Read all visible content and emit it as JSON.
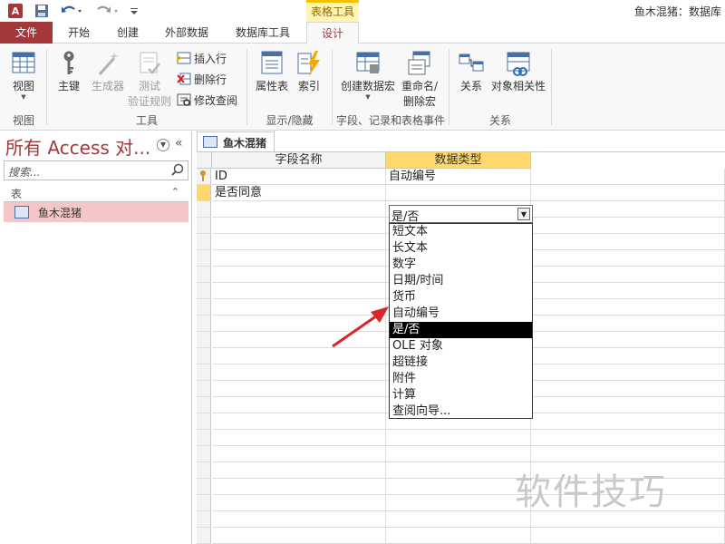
{
  "app_icon": "A",
  "context_tab": "表格工具",
  "window_title": "鱼木混猪：数据库",
  "tabs": [
    {
      "label": "文件"
    },
    {
      "label": "开始"
    },
    {
      "label": "创建"
    },
    {
      "label": "外部数据"
    },
    {
      "label": "数据库工具"
    },
    {
      "label": "设计"
    }
  ],
  "ribbon": {
    "view_label": "视图",
    "primary_key": "主键",
    "builder": "生成器",
    "test_rules_line1": "测试",
    "test_rules_line2": "验证规则",
    "insert_row": "插入行",
    "delete_row": "删除行",
    "modify_lookup": "修改查阅",
    "property_sheet": "属性表",
    "indexes": "索引",
    "create_macro": "创建数据宏",
    "rename_macro_line1": "重命名/",
    "rename_macro_line2": "删除宏",
    "relationships": "关系",
    "object_dependencies": "对象相关性",
    "groups": {
      "views": "视图",
      "tools": "工具",
      "show_hide": "显示/隐藏",
      "field_events": "字段、记录和表格事件",
      "relationships": "关系"
    }
  },
  "nav": {
    "title": "所有 Access 对...",
    "search_placeholder": "搜索...",
    "section": "表",
    "items": [
      {
        "label": "鱼木混猪"
      }
    ]
  },
  "doc": {
    "tab_label": "鱼木混猪",
    "columns": [
      "字段名称",
      "数据类型"
    ],
    "rows": [
      {
        "name": "ID",
        "type": "自动编号",
        "primary_key": true
      },
      {
        "name": "是否同意",
        "type": "是/否"
      }
    ]
  },
  "dropdown": {
    "value": "是/否",
    "options": [
      "短文本",
      "长文本",
      "数字",
      "日期/时间",
      "货币",
      "自动编号",
      "是/否",
      "OLE 对象",
      "超链接",
      "附件",
      "计算",
      "查阅向导..."
    ],
    "selected_index": 6
  },
  "watermark": "软件技巧",
  "colors": {
    "accent": "#a4373a",
    "selection": "#000000",
    "tools_tab": "#fff4b3",
    "arrow": "#d9262b"
  }
}
